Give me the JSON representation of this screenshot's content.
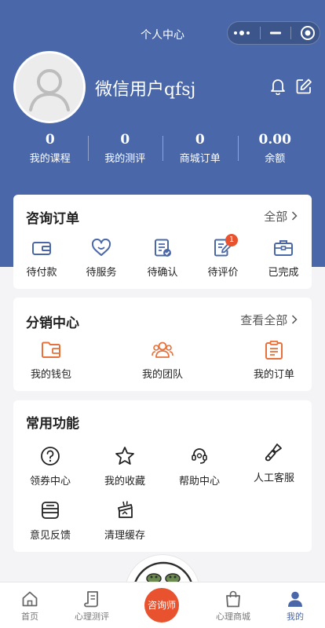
{
  "header": {
    "title": "个人中心",
    "username": "微信用户qfsj",
    "stats": [
      {
        "value": "0",
        "label": "我的课程"
      },
      {
        "value": "0",
        "label": "我的测评"
      },
      {
        "value": "0",
        "label": "商城订单"
      },
      {
        "value": "0.00",
        "label": "余额"
      }
    ]
  },
  "orders": {
    "title": "咨询订单",
    "more": "全部",
    "items": [
      {
        "label": "待付款",
        "icon": "wallet-icon"
      },
      {
        "label": "待服务",
        "icon": "heart-icon"
      },
      {
        "label": "待确认",
        "icon": "clipboard-check-icon"
      },
      {
        "label": "待评价",
        "icon": "edit-note-icon",
        "badge": "1"
      },
      {
        "label": "已完成",
        "icon": "briefcase-icon"
      }
    ]
  },
  "distribution": {
    "title": "分销中心",
    "more": "查看全部",
    "items": [
      {
        "label": "我的钱包",
        "icon": "folder-wallet-icon"
      },
      {
        "label": "我的团队",
        "icon": "team-icon"
      },
      {
        "label": "我的订单",
        "icon": "order-list-icon"
      }
    ]
  },
  "functions": {
    "title": "常用功能",
    "items": [
      {
        "label": "领券中心",
        "icon": "question-circle-icon"
      },
      {
        "label": "我的收藏",
        "icon": "star-icon"
      },
      {
        "label": "帮助中心",
        "icon": "headset-icon"
      },
      {
        "label": "人工客服",
        "icon": "brush-icon"
      },
      {
        "label": "意见反馈",
        "icon": "feedback-icon"
      },
      {
        "label": "清理缓存",
        "icon": "clean-icon"
      }
    ]
  },
  "tabbar": {
    "items": [
      {
        "label": "首页",
        "icon": "home-icon"
      },
      {
        "label": "心理测评",
        "icon": "scroll-icon"
      },
      {
        "label": "心理商城",
        "icon": "shopping-bag-icon"
      },
      {
        "label": "我的",
        "icon": "user-icon"
      }
    ],
    "center": "咨询师"
  },
  "colors": {
    "primary": "#4a68a9",
    "accent": "#e9522e",
    "orange": "#e8703a"
  }
}
